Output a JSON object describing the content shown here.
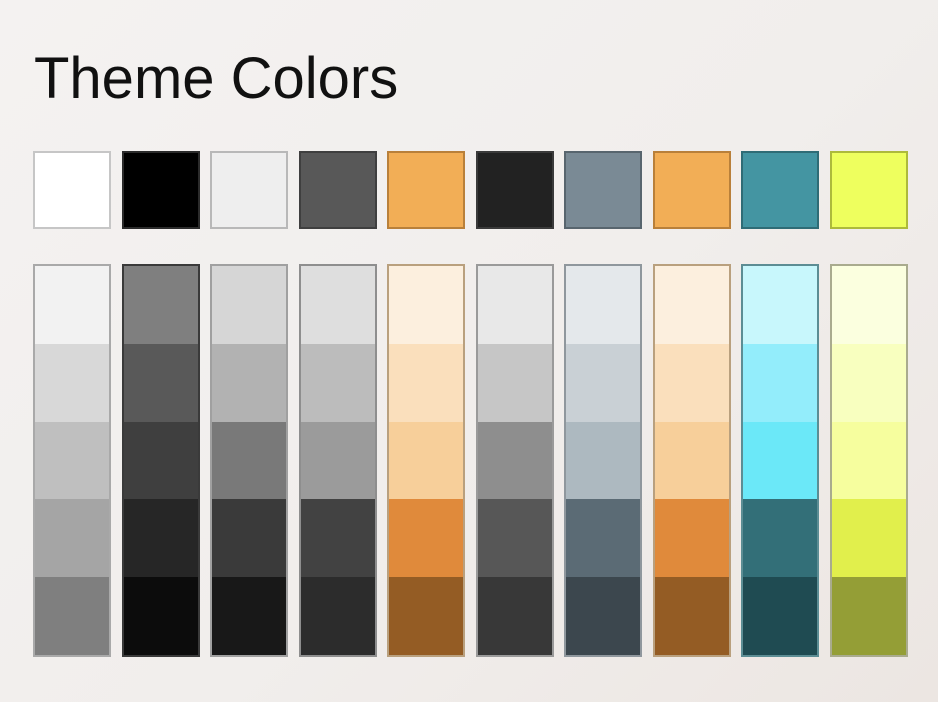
{
  "title": "Theme Colors",
  "theme_colors": [
    {
      "name": "background-1",
      "color": "#ffffff",
      "border": "#c6c6c6"
    },
    {
      "name": "text-1",
      "color": "#000000",
      "border": "#2b2b2b"
    },
    {
      "name": "background-2",
      "color": "#eeeeee",
      "border": "#b8b8b8"
    },
    {
      "name": "text-2",
      "color": "#585858",
      "border": "#3f3f3f"
    },
    {
      "name": "accent-1",
      "color": "#f2ae56",
      "border": "#b9803a"
    },
    {
      "name": "accent-2",
      "color": "#222222",
      "border": "#3a3a3a"
    },
    {
      "name": "accent-3",
      "color": "#7a8a95",
      "border": "#58656e"
    },
    {
      "name": "accent-4",
      "color": "#f2ae56",
      "border": "#b9803a"
    },
    {
      "name": "accent-5",
      "color": "#4495a2",
      "border": "#2f6c76"
    },
    {
      "name": "accent-6",
      "color": "#eeff5e",
      "border": "#adba3b"
    }
  ],
  "shade_columns": [
    {
      "name": "background-1",
      "border": "#a9a9a9",
      "shades": [
        "#f2f2f2",
        "#d8d8d8",
        "#bfbfbf",
        "#a5a5a5",
        "#7f7f7f"
      ]
    },
    {
      "name": "text-1",
      "border": "#3a3a3a",
      "shades": [
        "#7f7f7f",
        "#595959",
        "#3f3f3f",
        "#262626",
        "#0c0c0c"
      ]
    },
    {
      "name": "background-2",
      "border": "#a0a0a0",
      "shades": [
        "#d6d6d6",
        "#b2b2b2",
        "#797979",
        "#3a3a3a",
        "#181818"
      ]
    },
    {
      "name": "text-2",
      "border": "#8e8e8e",
      "shades": [
        "#dedede",
        "#bcbcbc",
        "#9b9b9b",
        "#424242",
        "#2c2c2c"
      ]
    },
    {
      "name": "accent-1",
      "border": "#b9a07e",
      "shades": [
        "#fcefde",
        "#fadfbc",
        "#f7cf9a",
        "#e08a3b",
        "#945c24"
      ]
    },
    {
      "name": "accent-2",
      "border": "#9a9a9a",
      "shades": [
        "#e8e8e8",
        "#c6c6c6",
        "#8e8e8e",
        "#575757",
        "#383838"
      ]
    },
    {
      "name": "accent-3",
      "border": "#8f979d",
      "shades": [
        "#e4e8eb",
        "#c9d0d5",
        "#adb9c0",
        "#5b6b75",
        "#3c474e"
      ]
    },
    {
      "name": "accent-4",
      "border": "#b9a07e",
      "shades": [
        "#fcefde",
        "#fadfbc",
        "#f7cf9a",
        "#e08a3b",
        "#945c24"
      ]
    },
    {
      "name": "accent-5",
      "border": "#5c8d94",
      "shades": [
        "#c8f7fc",
        "#93edfb",
        "#6be8f8",
        "#336f78",
        "#1f4b52"
      ]
    },
    {
      "name": "accent-6",
      "border": "#a9ab8e",
      "shades": [
        "#fbffdf",
        "#f8ffbf",
        "#f6fe9e",
        "#e1ef4c",
        "#949e36"
      ]
    }
  ]
}
